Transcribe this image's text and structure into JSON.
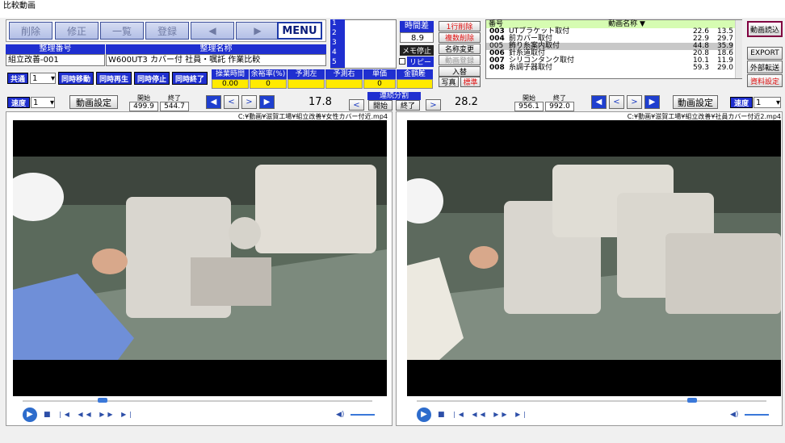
{
  "window": {
    "title": "比較動画"
  },
  "toolbar": {
    "buttons": [
      "削除",
      "修正",
      "一覧",
      "登録",
      "◀",
      "▶",
      "MENU"
    ]
  },
  "record": {
    "id_header": "整理番号",
    "name_header": "整理名称",
    "id_value": "組立改善-001",
    "name_value": "W600UT3 カバー付 社員・嘱託 作業比較"
  },
  "common": {
    "label": "共通",
    "select_value": "1"
  },
  "sync_buttons": [
    "同時移動",
    "同時再生",
    "同時停止",
    "同時終了"
  ],
  "metrics": {
    "headers": [
      "操業時間",
      "余裕率(%)",
      "予測左",
      "予測右",
      "単価",
      "金額差"
    ],
    "values": [
      "0.00",
      "0",
      "",
      "",
      "0",
      ""
    ]
  },
  "memo_lines": [
    "1",
    "2",
    "3",
    "4",
    "5"
  ],
  "time_diff": {
    "label": "時間差",
    "value": "8.9",
    "memo_stop": "メモ停止",
    "repeat": "リピート"
  },
  "side_buttons": [
    "1行削除",
    "複数削除",
    "名称変更",
    "動画登録",
    "入替",
    "写真",
    "標準"
  ],
  "video_list": {
    "col_no": "番号",
    "col_name": "動画名称 ▼",
    "rows": [
      {
        "no": "003",
        "name": "UTブラケット取付",
        "a": "22.6",
        "b": "13.5"
      },
      {
        "no": "004",
        "name": "前カバー取付",
        "a": "22.9",
        "b": "29.7"
      },
      {
        "no": "005",
        "name": "飾り糸案内取付",
        "a": "44.8",
        "b": "35.9"
      },
      {
        "no": "006",
        "name": "針糸道取付",
        "a": "20.8",
        "b": "18.6"
      },
      {
        "no": "007",
        "name": "シリコンタンク取付",
        "a": "10.1",
        "b": "11.9"
      },
      {
        "no": "008",
        "name": "糸調子器取付",
        "a": "59.3",
        "b": "29.0"
      }
    ]
  },
  "right_buttons": [
    "動画読込",
    "EXPORT",
    "外部転送",
    "資料設定"
  ],
  "left_player": {
    "speed_label": "速度",
    "speed_value": "1",
    "settings": "動画設定",
    "start_label": "開始",
    "end_label": "終了",
    "start": "499.9",
    "end": "544.7",
    "time": "17.8",
    "file": "C:¥動画¥滋賀工場¥組立改善¥女性カバー付近.mp4"
  },
  "center": {
    "label": "連続分割",
    "start": "開始",
    "end": "終了"
  },
  "right_player": {
    "speed_label": "速度",
    "speed_value": "1",
    "settings": "動画設定",
    "start_label": "開始",
    "end_label": "終了",
    "start": "956.1",
    "end": "992.0",
    "time": "28.2",
    "file": "C:¥動画¥滋賀工場¥組立改善¥社員カバー付近2.mp4"
  }
}
